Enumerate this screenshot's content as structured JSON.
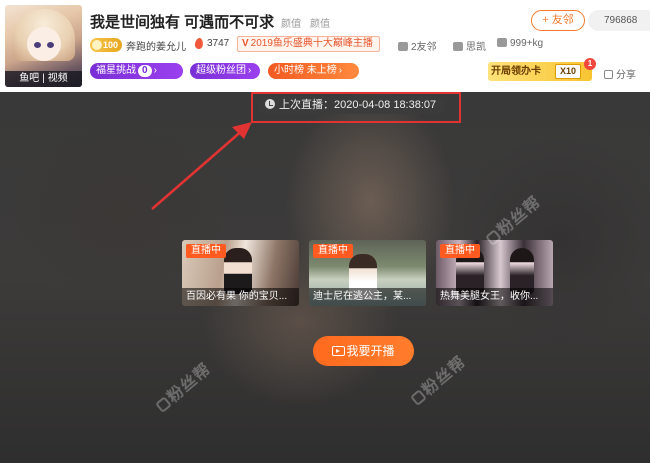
{
  "header": {
    "avatar_labels": [
      "鱼吧",
      "视频"
    ],
    "room_title": "我是世间独有 可遇而不可求",
    "categories": [
      "颜值",
      "颜值"
    ],
    "follow_label": "+ 友邻",
    "follow_count": "796868",
    "level_badge": "100",
    "owner_name": "奔跑的姜允儿",
    "hot_value": "3747",
    "event_tag_prefix": "V",
    "event_tag": "2019鱼乐盛典十大巅峰主播",
    "friends": "2友邻",
    "wealth": "思凯",
    "weight": "999+kg",
    "pills": {
      "star_challenge": {
        "label": "福星挑战",
        "value": "0",
        "chev": "›"
      },
      "super_fans": {
        "label": "超级粉丝团",
        "chev": "›"
      },
      "hourly_rank": {
        "label": "小时榜  未上榜",
        "chev": "›"
      }
    },
    "card_promo": {
      "label": "开局领办卡",
      "ticket": "X10",
      "badge": "1"
    },
    "share_label": "分享",
    "icons": {
      "level": "crown-icon",
      "hot": "fire-icon",
      "friends": "people-icon",
      "wealth": "home-icon",
      "weight": "weight-icon",
      "share": "share-icon"
    }
  },
  "stage": {
    "last_live_label": "上次直播：2020-04-08 18:38:07",
    "annotation_color": "#e23333",
    "live_tag": "直播中",
    "rooms": [
      {
        "title": "百因必有果 你的宝贝..."
      },
      {
        "title": "迪士尼在逃公主，某..."
      },
      {
        "title": "热舞美腿女王，收你..."
      }
    ],
    "start_button": "我要开播",
    "watermark": "粉丝帮"
  },
  "colors": {
    "accent": "#ff6a1f",
    "purple": "#8a36e6",
    "follow": "#f47b2d"
  }
}
